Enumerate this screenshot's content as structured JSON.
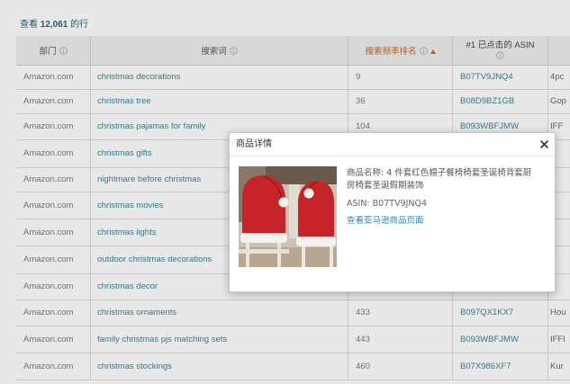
{
  "results": {
    "prefix": "查看",
    "count": "12,061",
    "suffix": "的行"
  },
  "colors": {
    "link": "#3a8595",
    "sorted_header": "#c56a26",
    "row_count": "#2b6579",
    "modal_link": "#2a87b3",
    "chair_cover_red": "#c7232a"
  },
  "table": {
    "columns": {
      "department": {
        "label": "部门",
        "icon": "info-icon"
      },
      "search_term": {
        "label": "搜索词",
        "icon": "info-icon"
      },
      "search_frequency_rank": {
        "label": "搜索频率排名",
        "icon": "info-icon",
        "sort_icon": "sort-ascending-icon",
        "sorted": "ascending"
      },
      "top_clicked_asin": {
        "label": "#1 已点击的 ASIN",
        "icon": "info-icon"
      }
    },
    "rows": [
      {
        "department": "Amazon.com",
        "search_term": "christmas decorations",
        "rank": "9",
        "asin": "B07TV9JNQ4",
        "title": "4pc"
      },
      {
        "department": "Amazon.com",
        "search_term": "christmas tree",
        "rank": "36",
        "asin": "B08D9BZ1GB",
        "title": "Gop"
      },
      {
        "department": "Amazon.com",
        "search_term": "christmas pajamas for family",
        "rank": "104",
        "asin": "B093WBFJMW",
        "title": "IFF"
      },
      {
        "department": "Amazon.com",
        "search_term": "christmas gifts"
      },
      {
        "department": "Amazon.com",
        "search_term": "nightmare before christmas"
      },
      {
        "department": "Amazon.com",
        "search_term": "christmas movies"
      },
      {
        "department": "Amazon.com",
        "search_term": "christmas lights"
      },
      {
        "department": "Amazon.com",
        "search_term": "outdoor christmas decorations"
      },
      {
        "department": "Amazon.com",
        "search_term": "christmas decor"
      },
      {
        "department": "Amazon.com",
        "search_term": "christmas ornaments",
        "rank": "433",
        "asin": "B097QX1KX7",
        "title": "Hou"
      },
      {
        "department": "Amazon.com",
        "search_term": "family christmas pjs matching sets",
        "rank": "443",
        "asin": "B093WBFJMW",
        "title": "IFFI"
      },
      {
        "department": "Amazon.com",
        "search_term": "christmas stockings",
        "rank": "460",
        "asin": "B07X986XF7",
        "title": "Kur"
      }
    ]
  },
  "modal": {
    "title": "商品详情",
    "close_icon": "close-icon",
    "image": "product-image",
    "product_name": "商品名称: 4 件套红色帽子餐椅椅套圣诞椅背套厨房椅套圣诞假期装饰",
    "asin_line": "ASIN: B07TV9JNQ4",
    "link_label": "查看亚马逊商品页面"
  }
}
